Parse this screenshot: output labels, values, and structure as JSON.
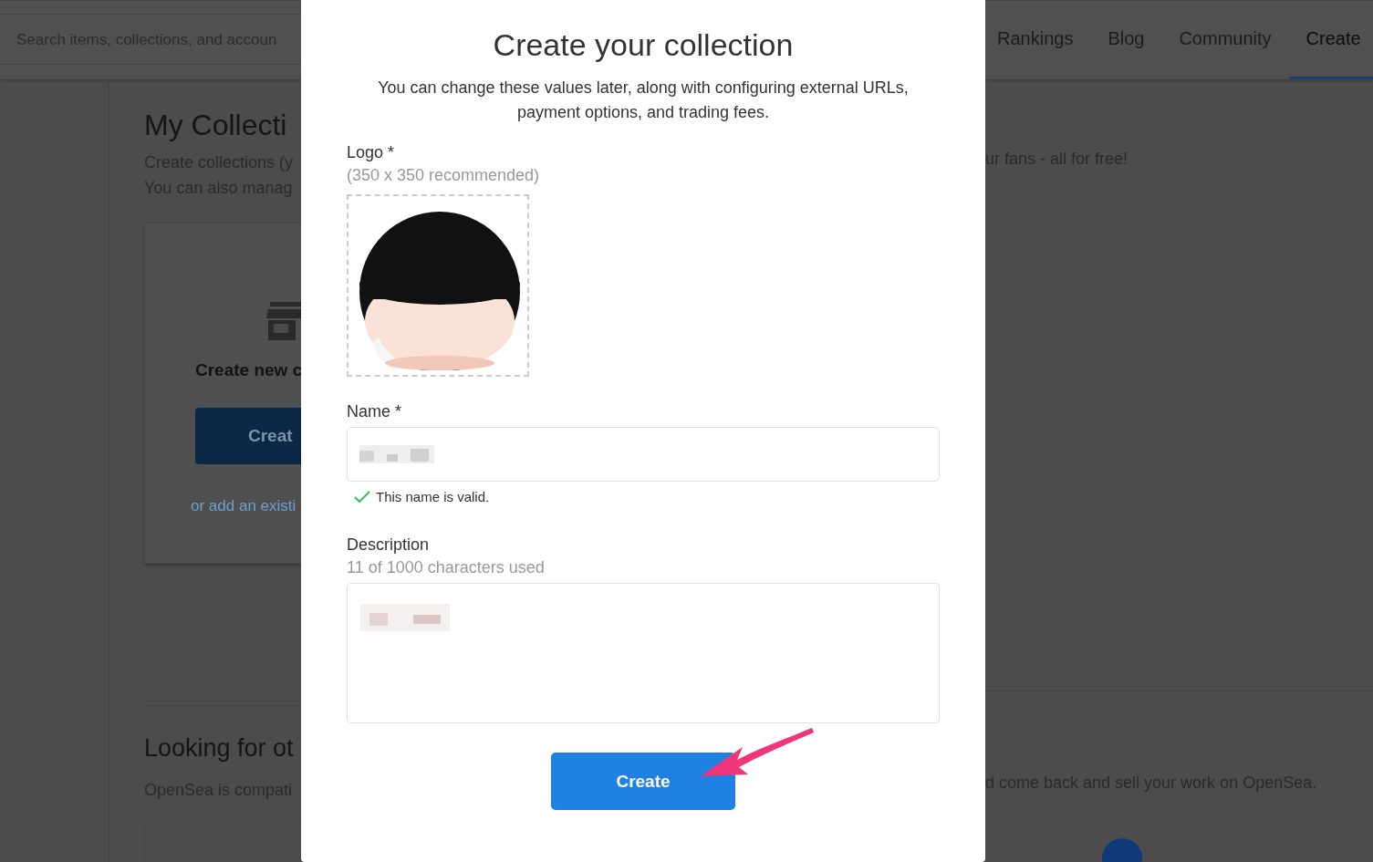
{
  "header": {
    "search": {
      "placeholder": "Search items, collections, and accoun"
    },
    "nav": [
      {
        "label": "Rankings",
        "selected": false
      },
      {
        "label": "Blog",
        "selected": false
      },
      {
        "label": "Community",
        "selected": false
      },
      {
        "label": "Create",
        "selected": true
      }
    ]
  },
  "page": {
    "title": "My Collecti",
    "lines": [
      "Create collections (y",
      "You can also manag"
    ],
    "line_right": "ur fans - all for free!",
    "card": {
      "heading": "Create new c",
      "button": "Creat",
      "link": "or add an existi"
    },
    "section_title": "Looking for ot",
    "section_text": "OpenSea is compati",
    "section_text_right": "d come back and sell your work on OpenSea."
  },
  "modal": {
    "title": "Create your collection",
    "subtitle": "You can change these values later, along with configuring external URLs, payment options, and trading fees.",
    "logo": {
      "label": "Logo *",
      "hint": "(350 x 350 recommended)"
    },
    "name": {
      "label": "Name *",
      "valid": true,
      "message": "This name is valid."
    },
    "description": {
      "label": "Description",
      "count": "11 of 1000 characters used"
    },
    "button": "Create"
  }
}
